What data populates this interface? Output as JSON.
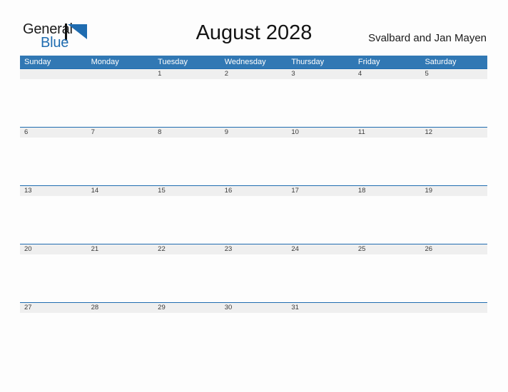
{
  "brand": {
    "name_part1": "General",
    "name_part2": "Blue",
    "logo_icon": "blue-triangle-icon",
    "accent_color": "#1f6cb0"
  },
  "header": {
    "title": "August 2028",
    "location": "Svalbard and Jan Mayen"
  },
  "calendar": {
    "header_bg": "#3178b4",
    "date_band_bg": "#efefef",
    "rule_color": "#1f6cb0",
    "weekday_headers": [
      "Sunday",
      "Monday",
      "Tuesday",
      "Wednesday",
      "Thursday",
      "Friday",
      "Saturday"
    ],
    "weeks": [
      {
        "days": [
          "",
          "",
          "1",
          "2",
          "3",
          "4",
          "5"
        ]
      },
      {
        "days": [
          "6",
          "7",
          "8",
          "9",
          "10",
          "11",
          "12"
        ]
      },
      {
        "days": [
          "13",
          "14",
          "15",
          "16",
          "17",
          "18",
          "19"
        ]
      },
      {
        "days": [
          "20",
          "21",
          "22",
          "23",
          "24",
          "25",
          "26"
        ]
      },
      {
        "days": [
          "27",
          "28",
          "29",
          "30",
          "31",
          "",
          ""
        ]
      }
    ]
  }
}
